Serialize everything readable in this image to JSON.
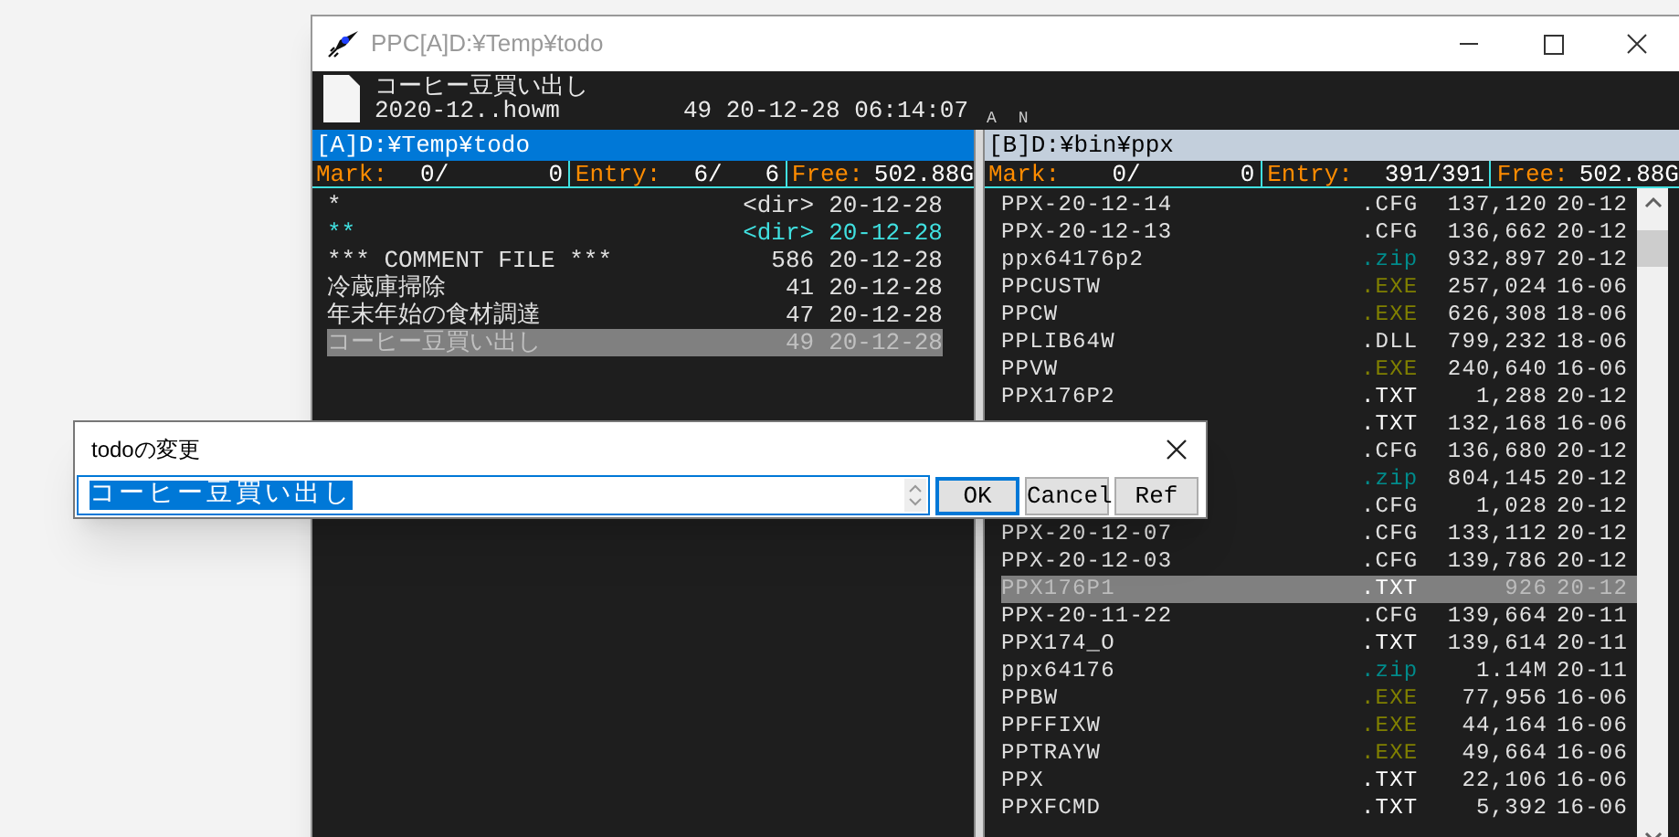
{
  "window": {
    "title": "PPC[A]D:¥Temp¥todo"
  },
  "info": {
    "name": "コーヒー豆買い出し",
    "file": "2020-12..howm",
    "details": "49 20-12-28 06:14:07",
    "attributes": [
      "A",
      "N"
    ]
  },
  "left_pane": {
    "path": "[A]D:¥Temp¥todo",
    "active": true,
    "mark_label": "Mark:",
    "mark": "0/       0",
    "entry_label": "Entry:",
    "entry": "6/   6",
    "free_label": "Free:",
    "free": "502.88G",
    "rows": [
      {
        "name": "*",
        "size": "<dir>",
        "date": "20-12-28",
        "color": "#e0e0e0",
        "selected": false
      },
      {
        "name": "**",
        "size": "<dir>",
        "date": "20-12-28",
        "color": "#40e0e0",
        "selected": false
      },
      {
        "name": "*** COMMENT FILE ***",
        "size": "586",
        "date": "20-12-28",
        "color": "#e0e0e0",
        "selected": false
      },
      {
        "name": "冷蔵庫掃除",
        "size": "41",
        "date": "20-12-28",
        "color": "#e0e0e0",
        "selected": false
      },
      {
        "name": "年末年始の食材調達",
        "size": "47",
        "date": "20-12-28",
        "color": "#e0e0e0",
        "selected": false
      },
      {
        "name": "コーヒー豆買い出し",
        "size": "49",
        "date": "20-12-28",
        "selected": true
      }
    ]
  },
  "right_pane": {
    "path": "[B]D:¥bin¥ppx",
    "active": false,
    "mark_label": "Mark:",
    "mark": "0/       0",
    "entry_label": "Entry:",
    "entry": "391/391",
    "free_label": "Free:",
    "free": "502.88G",
    "rows": [
      {
        "name": "PPX-20-12-14",
        "ext": ".CFG",
        "size": "137,120",
        "date": "20-12",
        "color": "#e0e0e0",
        "selected": false
      },
      {
        "name": "PPX-20-12-13",
        "ext": ".CFG",
        "size": "136,662",
        "date": "20-12",
        "color": "#e0e0e0",
        "selected": false
      },
      {
        "name": "ppx64176p2",
        "ext": ".zip",
        "size": "932,897",
        "date": "20-12",
        "color": "#008b8b",
        "selected": false
      },
      {
        "name": "PPCUSTW",
        "ext": ".EXE",
        "size": "257,024",
        "date": "16-06",
        "color": "#808000",
        "selected": false
      },
      {
        "name": "PPCW",
        "ext": ".EXE",
        "size": "626,308",
        "date": "18-06",
        "color": "#808000",
        "selected": false
      },
      {
        "name": "PPLIB64W",
        "ext": ".DLL",
        "size": "799,232",
        "date": "18-06",
        "color": "#e0e0e0",
        "selected": false
      },
      {
        "name": "PPVW",
        "ext": ".EXE",
        "size": "240,640",
        "date": "16-06",
        "color": "#808000",
        "selected": false
      },
      {
        "name": "PPX176P2",
        "ext": ".TXT",
        "size": "1,288",
        "date": "20-12",
        "color": "#ffffff",
        "selected": false
      },
      {
        "ext": ".TXT",
        "size": "132,168",
        "date": "16-06",
        "color": "#ffffff",
        "selected": false
      },
      {
        "ext": ".CFG",
        "size": "136,680",
        "date": "20-12",
        "color": "#e0e0e0",
        "selected": false
      },
      {
        "ext": ".zip",
        "size": "804,145",
        "date": "20-12",
        "color": "#008b8b",
        "selected": false
      },
      {
        "ext": ".CFG",
        "size": "1,028",
        "date": "20-12",
        "color": "#e0e0e0",
        "selected": false
      },
      {
        "name": "PPX-20-12-07",
        "ext": ".CFG",
        "size": "133,112",
        "date": "20-12",
        "color": "#e0e0e0",
        "selected": false
      },
      {
        "name": "PPX-20-12-03",
        "ext": ".CFG",
        "size": "139,786",
        "date": "20-12",
        "color": "#e0e0e0",
        "selected": false
      },
      {
        "name": "PPX176P1",
        "ext": ".TXT",
        "size": "926",
        "date": "20-12",
        "selected": true
      },
      {
        "name": "PPX-20-11-22",
        "ext": ".CFG",
        "size": "139,664",
        "date": "20-11",
        "color": "#e0e0e0",
        "selected": false
      },
      {
        "name": "PPX174_O",
        "ext": ".TXT",
        "size": "139,614",
        "date": "20-11",
        "color": "#ffffff",
        "selected": false
      },
      {
        "name": "ppx64176",
        "ext": ".zip",
        "size": "1.14M",
        "date": "20-11",
        "color": "#008b8b",
        "selected": false
      },
      {
        "name": "PPBW",
        "ext": ".EXE",
        "size": "77,956",
        "date": "16-06",
        "color": "#808000",
        "selected": false
      },
      {
        "name": "PPFFIXW",
        "ext": ".EXE",
        "size": "44,164",
        "date": "16-06",
        "color": "#808000",
        "selected": false
      },
      {
        "name": "PPTRAYW",
        "ext": ".EXE",
        "size": "49,664",
        "date": "16-06",
        "color": "#808000",
        "selected": false
      },
      {
        "name": "PPX",
        "ext": ".TXT",
        "size": "22,106",
        "date": "16-06",
        "color": "#ffffff",
        "selected": false
      },
      {
        "name": "PPXFCMD",
        "ext": ".TXT",
        "size": "5,392",
        "date": "16-06",
        "color": "#ffffff",
        "selected": false
      }
    ]
  },
  "dialog": {
    "title": "todoの変更",
    "value": "コーヒー豆買い出し",
    "buttons": [
      {
        "label": "OK",
        "selected": true
      },
      {
        "label": "Cancel",
        "selected": false
      },
      {
        "label": "Ref",
        "selected": false
      }
    ]
  }
}
